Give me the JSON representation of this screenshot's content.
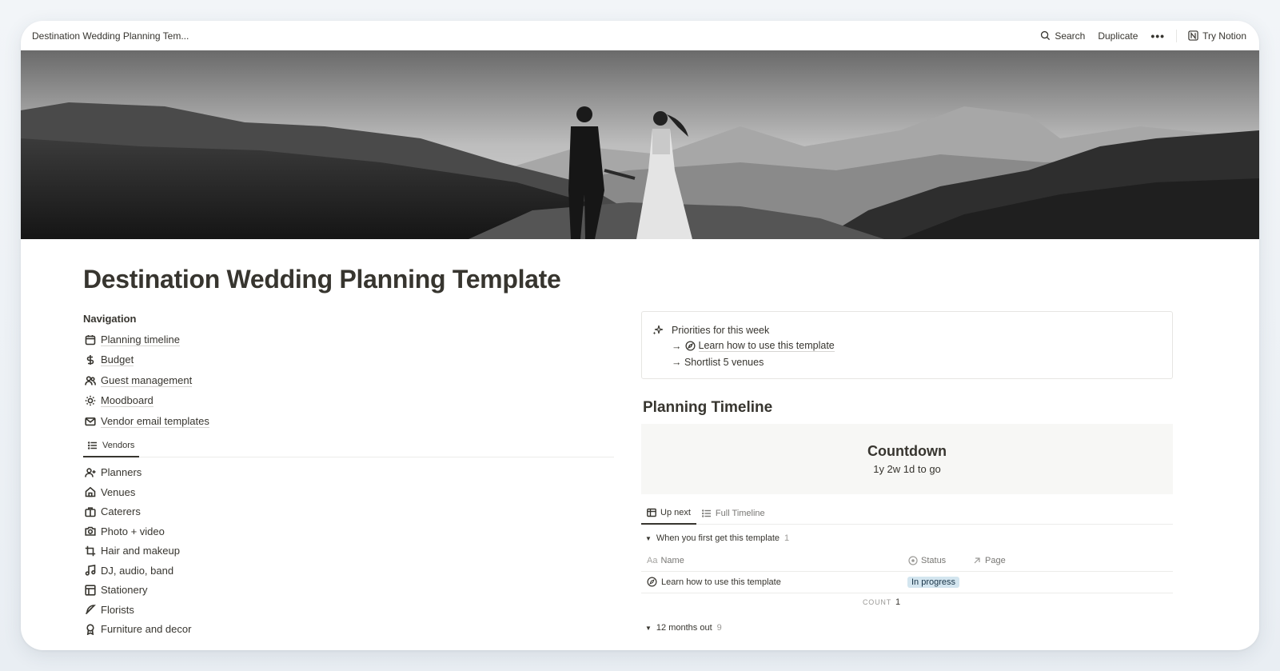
{
  "topbar": {
    "title": "Destination Wedding Planning Tem...",
    "search_label": "Search",
    "duplicate_label": "Duplicate",
    "more_label": "•••",
    "try_label": "Try Notion"
  },
  "page": {
    "title": "Destination Wedding Planning Template"
  },
  "navigation": {
    "heading": "Navigation",
    "items": [
      {
        "label": "Planning timeline",
        "icon": "calendar-icon"
      },
      {
        "label": "Budget",
        "icon": "dollar-icon"
      },
      {
        "label": "Guest management",
        "icon": "people-icon"
      },
      {
        "label": "Moodboard",
        "icon": "sun-icon"
      },
      {
        "label": "Vendor email templates",
        "icon": "mail-icon"
      }
    ]
  },
  "vendors_tab": {
    "label": "Vendors"
  },
  "vendors": [
    {
      "label": "Planners",
      "icon": "person-add-icon"
    },
    {
      "label": "Venues",
      "icon": "home-icon"
    },
    {
      "label": "Caterers",
      "icon": "briefcase-icon"
    },
    {
      "label": "Photo + video",
      "icon": "camera-icon"
    },
    {
      "label": "Hair and makeup",
      "icon": "crop-icon"
    },
    {
      "label": "DJ, audio, band",
      "icon": "music-icon"
    },
    {
      "label": "Stationery",
      "icon": "layout-icon"
    },
    {
      "label": "Florists",
      "icon": "feather-icon"
    },
    {
      "label": "Furniture and decor",
      "icon": "award-icon"
    }
  ],
  "callout": {
    "title": "Priorities for this week",
    "line1_arrow": "→",
    "line1_link": "Learn how to use this template",
    "line2": "→ Shortlist 5 venues"
  },
  "timeline": {
    "heading": "Planning Timeline",
    "countdown_title": "Countdown",
    "countdown_value": "1y 2w 1d to go",
    "tabs": [
      {
        "label": "Up next",
        "active": true
      },
      {
        "label": "Full Timeline",
        "active": false
      }
    ],
    "group1": {
      "label": "When you first get this template",
      "count": "1"
    },
    "columns": {
      "name": "Name",
      "status": "Status",
      "page": "Page",
      "name_prefix": "Aa"
    },
    "row": {
      "name": "Learn how to use this template",
      "status": "In progress"
    },
    "count_label": "COUNT",
    "count_value": "1",
    "group2": {
      "label": "12 months out",
      "count": "9"
    }
  },
  "colors": {
    "text": "#37352f",
    "status_pill_bg": "#d3e5ef",
    "countdown_bg": "#f7f7f5"
  }
}
